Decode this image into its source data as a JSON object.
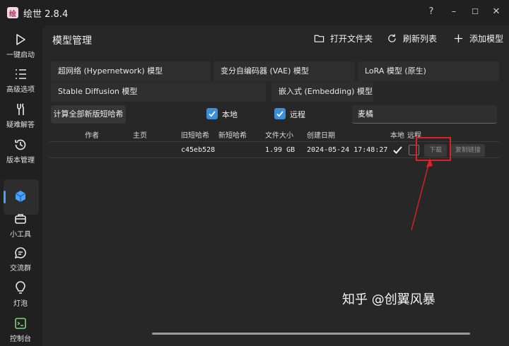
{
  "window": {
    "title": "绘世 2.8.4",
    "logo_text": "绘",
    "controls": [
      "?",
      "–",
      "☐",
      "✕"
    ]
  },
  "sidebar": {
    "items": [
      {
        "label": "一键启动",
        "icon": "play-icon"
      },
      {
        "label": "高级选项",
        "icon": "list-icon"
      },
      {
        "label": "疑难解答",
        "icon": "wrench-icon"
      },
      {
        "label": "版本管理",
        "icon": "history-icon"
      },
      {
        "label": "",
        "icon": "cube-icon",
        "active": true
      },
      {
        "label": "小工具",
        "icon": "toolbox-icon"
      },
      {
        "label": "交流群",
        "icon": "chat-icon"
      },
      {
        "label": "灯泡",
        "icon": "bulb-icon"
      },
      {
        "label": "控制台",
        "icon": "console-icon"
      }
    ]
  },
  "header": {
    "title": "模型管理",
    "open_folder": "打开文件夹",
    "refresh": "刷新列表",
    "add_model": "添加模型"
  },
  "tabs": [
    "超网络 (Hypernetwork) 模型",
    "变分自编码器 (VAE) 模型",
    "LoRA 模型 (原生)",
    "Stable Diffusion 模型",
    "嵌入式 (Embedding) 模型"
  ],
  "toolbar": {
    "calc_button": "计算全部新版短哈希",
    "local_label": "本地",
    "local_checked": true,
    "remote_label": "远程",
    "remote_checked": true,
    "search_value": "麦橘"
  },
  "table": {
    "columns": [
      "作者",
      "主页",
      "旧短哈希",
      "新短哈希",
      "文件大小",
      "创建日期",
      "本地",
      "远程"
    ],
    "rows": [
      {
        "author": "",
        "homepage": "",
        "old_hash": "c45eb528",
        "new_hash": "",
        "size": "1.99 GB",
        "created": "2024-05-24 17:48:27",
        "local": true,
        "remote": false,
        "download_label": "下载",
        "copy_link_label": "复制链接"
      }
    ]
  },
  "watermark": "知乎 @创翼风暴",
  "colors": {
    "accent": "#3b8fd9",
    "annotation_red": "#e02020",
    "background": "#1f1f1f",
    "panel": "#272727"
  }
}
